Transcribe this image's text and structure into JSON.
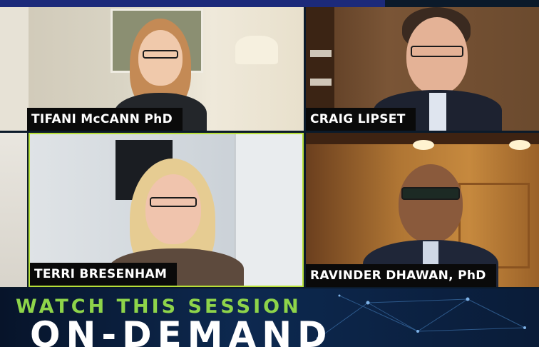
{
  "participants": [
    {
      "name": "TIFANI McCANN PhD",
      "speaking": false
    },
    {
      "name": "CRAIG LIPSET",
      "speaking": false
    },
    {
      "name": "TERRI BRESENHAM",
      "speaking": true
    },
    {
      "name": "RAVINDER DHAWAN, PhD",
      "speaking": false
    }
  ],
  "banner": {
    "line1": "WATCH THIS SESSION",
    "line2": "ON-DEMAND"
  },
  "colors": {
    "active_speaker_border": "#b8e03a",
    "banner_line1": "#8ed44a",
    "banner_line2": "#ffffff",
    "nameplate_bg": "#0a0a0a"
  }
}
